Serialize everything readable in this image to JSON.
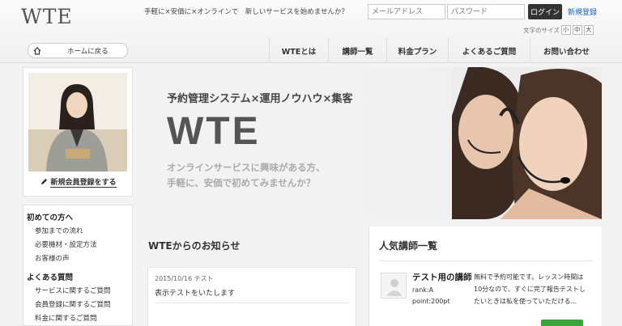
{
  "header": {
    "logo": "WTE",
    "tagline": "手軽に×安価に×オンラインで　新しいサービスを始めませんか？",
    "email_placeholder": "メールアドレス",
    "password_placeholder": "パスワード",
    "login_label": "ログイン",
    "register_label": "新規登録",
    "fontsize_label": "文字のサイズ",
    "fontsize_options": [
      "小",
      "中",
      "大"
    ],
    "home_label": "ホームに戻る"
  },
  "nav": {
    "items": [
      {
        "label": "WTEとは"
      },
      {
        "label": "講師一覧"
      },
      {
        "label": "料金プラン"
      },
      {
        "label": "よくあるご質問"
      },
      {
        "label": "お問い合わせ"
      }
    ]
  },
  "sidebar": {
    "signup_label": "新規会員登録をする",
    "sections": [
      {
        "heading": "初めての方へ",
        "items": [
          "参加までの流れ",
          "必要機材・設定方法",
          "お客様の声"
        ]
      },
      {
        "heading": "よくある質問",
        "items": [
          "サービスに関するご質問",
          "会員登録に関するご質問",
          "料金に関するご質問"
        ]
      }
    ]
  },
  "hero": {
    "subtitle": "予約管理システム×運用ノウハウ×集客",
    "title": "WTE",
    "desc_line1": "オンラインサービスに興味がある方、",
    "desc_line2": "手軽に、安価で初めてみませんか？"
  },
  "news": {
    "title": "WTEからのお知らせ",
    "items": [
      {
        "date": "2015/10/16 テスト",
        "text": "表示テストをいたします"
      }
    ]
  },
  "popular": {
    "title": "人気講師一覧",
    "teachers": [
      {
        "name": "テスト用の講師",
        "rank": "rank:A",
        "point": "point:200pt",
        "desc": "無料で予約可能です。レッスン時間は10分なので、すぐに完了報告テストしたいときは私を使っていただける..."
      }
    ]
  },
  "colors": {
    "login_button": "#333333",
    "register_link": "#1a5fb4",
    "detail_button": "#3aa53a"
  }
}
